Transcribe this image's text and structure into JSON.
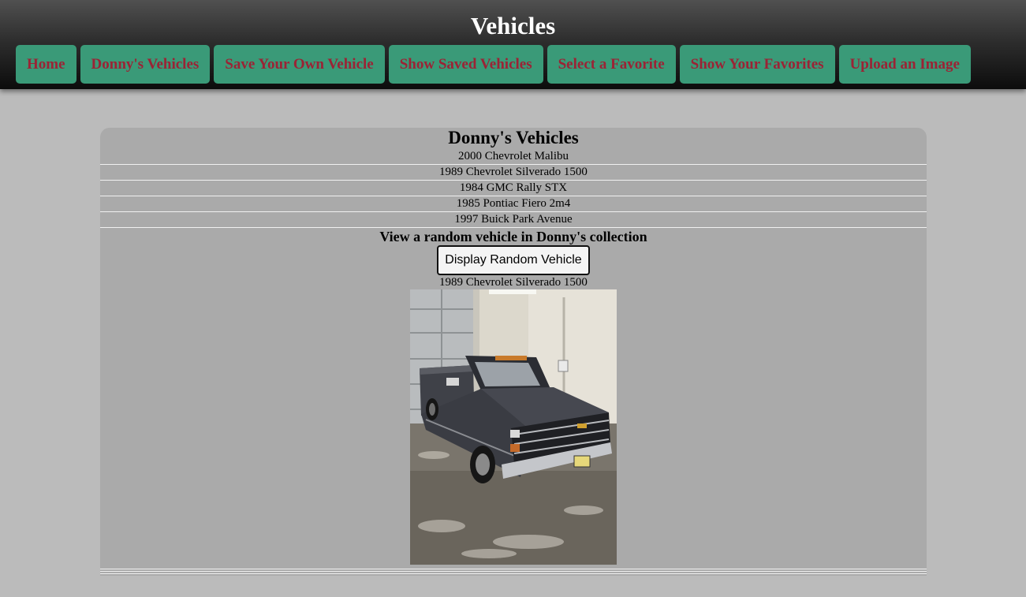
{
  "header": {
    "title": "Vehicles",
    "nav": [
      {
        "label": "Home"
      },
      {
        "label": "Donny's Vehicles"
      },
      {
        "label": "Save Your Own Vehicle"
      },
      {
        "label": "Show Saved Vehicles"
      },
      {
        "label": "Select a Favorite"
      },
      {
        "label": "Show Your Favorites"
      },
      {
        "label": "Upload an Image"
      }
    ]
  },
  "main": {
    "title": "Donny's Vehicles",
    "vehicles": [
      "2000 Chevrolet Malibu",
      "1989 Chevrolet Silverado 1500",
      "1984 GMC Rally STX",
      "1985 Pontiac Fiero 2m4",
      "1997 Buick Park Avenue"
    ],
    "random_heading": "View a random vehicle in Donny's collection",
    "random_button": "Display Random Vehicle",
    "random_result": "1989 Chevrolet Silverado 1500"
  },
  "colors": {
    "header_top": "#505050",
    "header_bottom": "#0c0c0c",
    "nav_button_bg": "#3a9a78",
    "nav_button_text": "#9b2335",
    "page_bg": "#bbbbbb",
    "card_bg": "#aaaaaa"
  }
}
